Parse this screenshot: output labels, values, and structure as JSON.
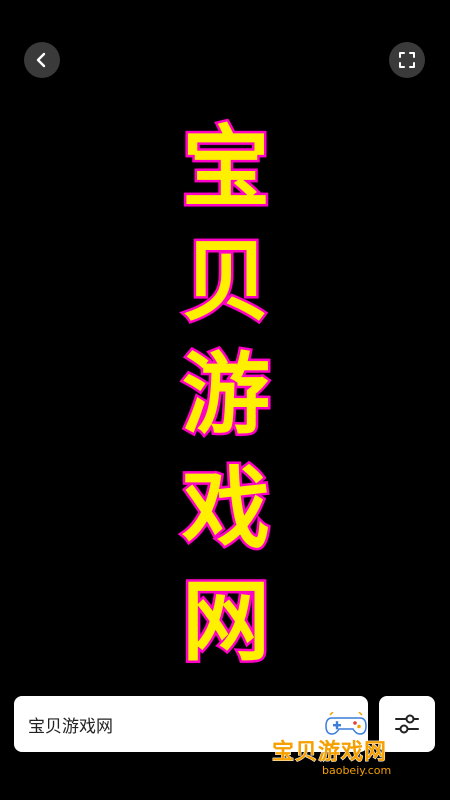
{
  "header": {
    "back_icon": "chevron-left-icon",
    "fullscreen_icon": "fullscreen-icon"
  },
  "preview": {
    "characters": [
      "宝",
      "贝",
      "游",
      "戏",
      "网"
    ],
    "fill_color": "#fff000",
    "stroke_color": "#ff00c8"
  },
  "input": {
    "value": "宝贝游戏网"
  },
  "settings": {
    "icon": "sliders-icon"
  },
  "watermark": {
    "title": "宝贝游戏网",
    "url": "baobeiy.com",
    "icon": "gamepad-icon",
    "color": "#f6a000"
  }
}
